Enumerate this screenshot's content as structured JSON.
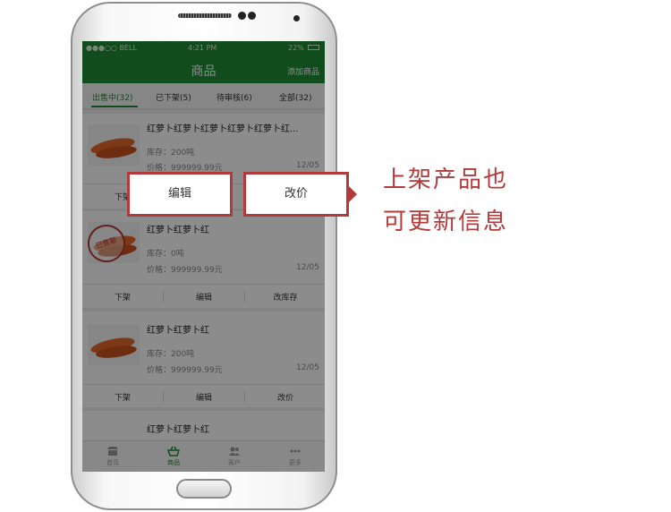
{
  "status_bar": {
    "carrier": "●●●○○ BELL",
    "time": "4:21 PM",
    "battery": "22%"
  },
  "header": {
    "title": "商品",
    "add_button": "添加商品"
  },
  "tabs": [
    {
      "label": "出售中(32)"
    },
    {
      "label": "已下架(5)"
    },
    {
      "label": "待审核(6)"
    },
    {
      "label": "全部(32)"
    }
  ],
  "products": [
    {
      "name": "红萝卜红萝卜红萝卜红萝卜红萝卜红...",
      "stock": "库存：200吨",
      "price": "价格：999999.99元",
      "date": "12/05",
      "actions": [
        "下架",
        "编辑",
        "改价"
      ]
    },
    {
      "name": "红萝卜红萝卜红",
      "stock": "库存：0吨",
      "price": "价格：999999.99元",
      "date": "12/05",
      "stamp": "已售罄",
      "actions": [
        "下架",
        "编辑",
        "改库存"
      ]
    },
    {
      "name": "红萝卜红萝卜红",
      "stock": "库存：200吨",
      "price": "价格：999999.99元",
      "date": "12/05",
      "actions": [
        "下架",
        "编辑",
        "改价"
      ]
    },
    {
      "name": "红萝卜红萝卜红"
    }
  ],
  "bottom_nav": [
    {
      "label": "首页",
      "icon": "shop-icon"
    },
    {
      "label": "商品",
      "icon": "basket-icon"
    },
    {
      "label": "客户",
      "icon": "customers-icon"
    },
    {
      "label": "更多",
      "icon": "more-icon"
    }
  ],
  "popup": {
    "edit_label": "编辑",
    "price_label": "改价"
  },
  "annotation": {
    "line1": "上架产品也",
    "line2": "可更新信息"
  },
  "colors": {
    "brand_green": "#1e8a33",
    "annotation_red": "#b23a3a"
  }
}
